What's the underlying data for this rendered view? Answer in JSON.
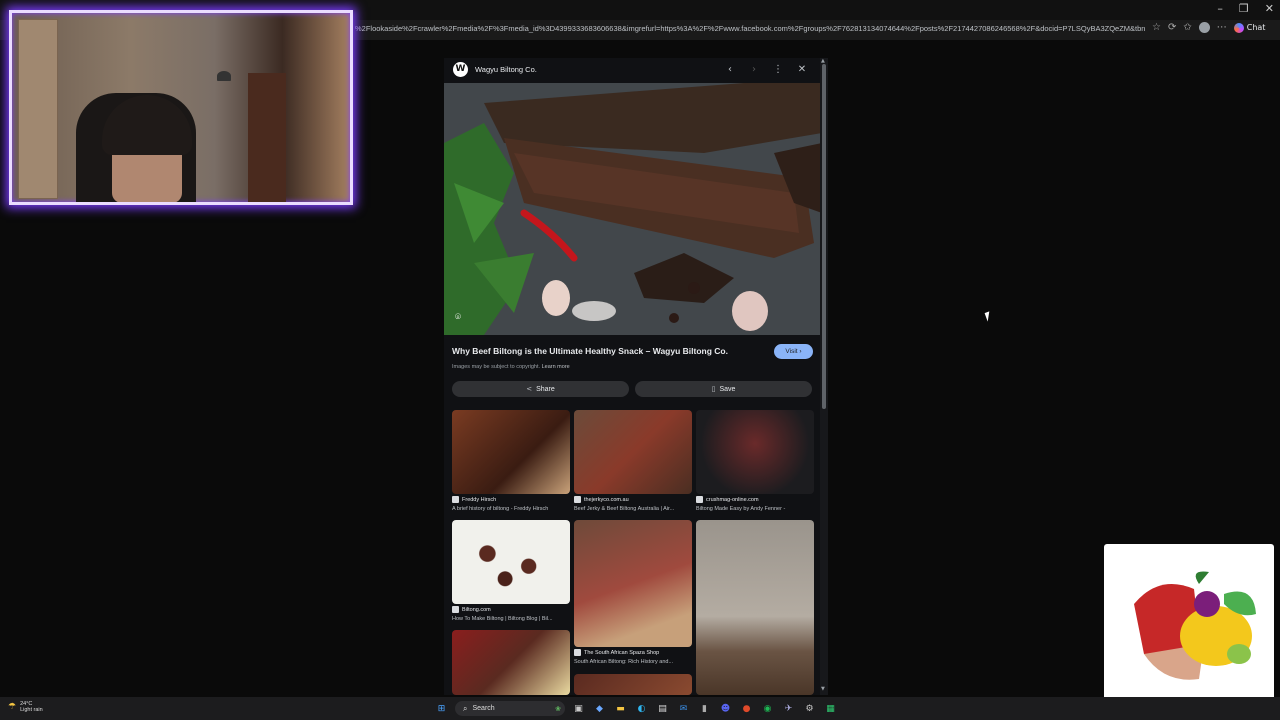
{
  "browser": {
    "url": "%2Flookaside%2Fcrawler%2Fmedia%2F%3Fmedia_id%3D4399333683606638&imgrefurl=https%3A%2F%2Fwww.facebook.com%2Fgroups%2F762813134074644%2Fposts%2F2174427086246568%2F&docid=P7LSQyBA3ZQeZM&tbnid=UqOegle4WPnTMikv...",
    "chat_label": "Chat"
  },
  "viewer": {
    "site_name": "Wagyu Biltong Co.",
    "title": "Why Beef Biltong is the Ultimate Healthy Snack – Wagyu Biltong Co.",
    "visit_label": "Visit",
    "copyright_text": "Images may be subject to copyright.",
    "learn_more": "Learn more",
    "share_label": "Share",
    "save_label": "Save"
  },
  "related": [
    {
      "source": "Freddy Hirsch",
      "title": "A brief history of biltong - Freddy Hirsch"
    },
    {
      "source": "thejerkyco.com.au",
      "title": "Beef Jerky & Beef Biltong Australia | Air..."
    },
    {
      "source": "crushmag-online.com",
      "title": "Biltong Made Easy by Andy Fenner -"
    },
    {
      "source": "Biltong.com",
      "title": "How To Make Biltong | Biltong Blog | Bil..."
    },
    {
      "source": "The South African Spaza Shop",
      "title": "South African Biltong: Rich History and..."
    }
  ],
  "taskbar": {
    "temperature": "24°C",
    "weather": "Light rain",
    "search_label": "Search"
  },
  "icons": {
    "back": "chevron-left-icon",
    "forward": "chevron-right-icon",
    "more": "more-vert-icon",
    "close": "close-icon",
    "lens": "lens-icon"
  }
}
